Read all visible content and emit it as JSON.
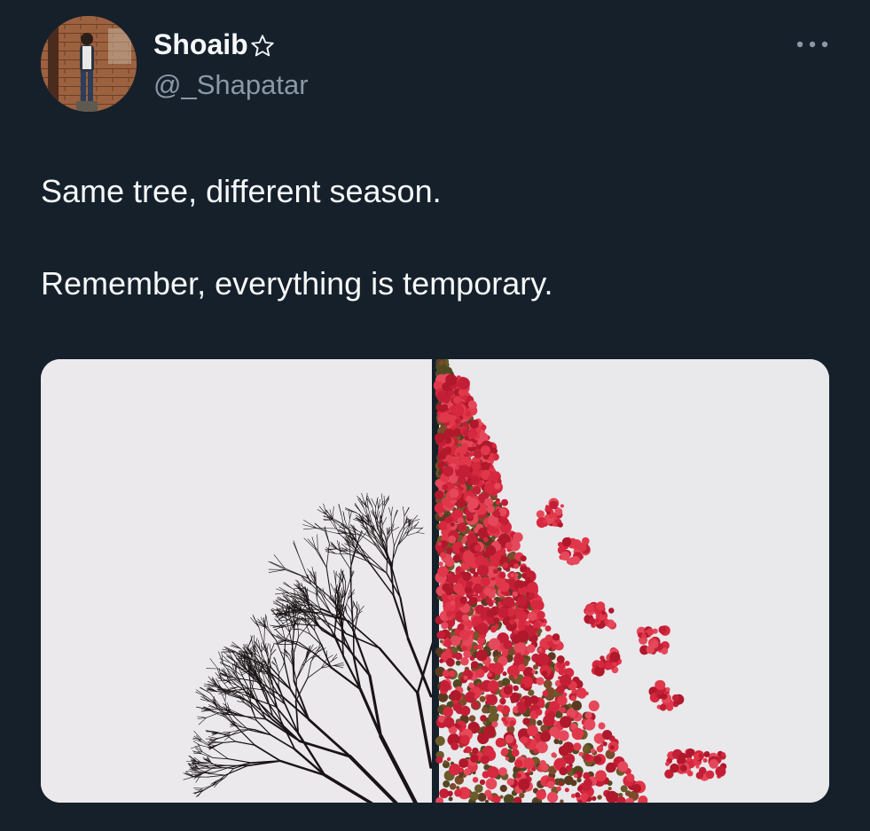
{
  "tweet": {
    "author": {
      "display_name": "Shoaib",
      "badge_icon": "star-outline-icon",
      "handle": "@_Shapatar",
      "avatar_icon": "avatar-photo"
    },
    "more_icon": "more-options-icon",
    "paragraphs": [
      "Same tree, different season.",
      "Remember, everything is temporary."
    ],
    "media": {
      "type": "photo",
      "panels": [
        {
          "subject": "bare-tree-branches"
        },
        {
          "subject": "red-flowering-tree"
        }
      ]
    }
  },
  "colors": {
    "background": "#15202b",
    "text_primary": "#f7f9f9",
    "text_secondary": "#8b98a5",
    "flower_red": "#d6283e",
    "sky": "#ebe9ec"
  }
}
